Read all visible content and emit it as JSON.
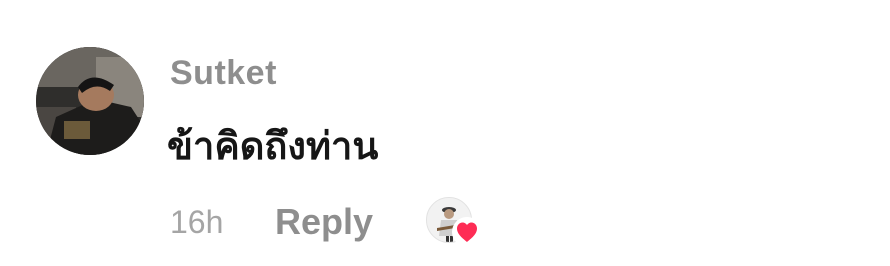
{
  "comment": {
    "username": "Sutket",
    "text": "ข้าคิดถึงท่าน",
    "time_ago": "16h",
    "reply_label": "Reply"
  },
  "avatar_icon": "user-avatar-photo",
  "liker_icon": "liker-avatar-photo",
  "heart_icon": "heart-icon",
  "colors": {
    "username": "#8e8e8e",
    "text": "#161616",
    "meta": "#a5a5a5",
    "heart": "#fe2c55"
  }
}
